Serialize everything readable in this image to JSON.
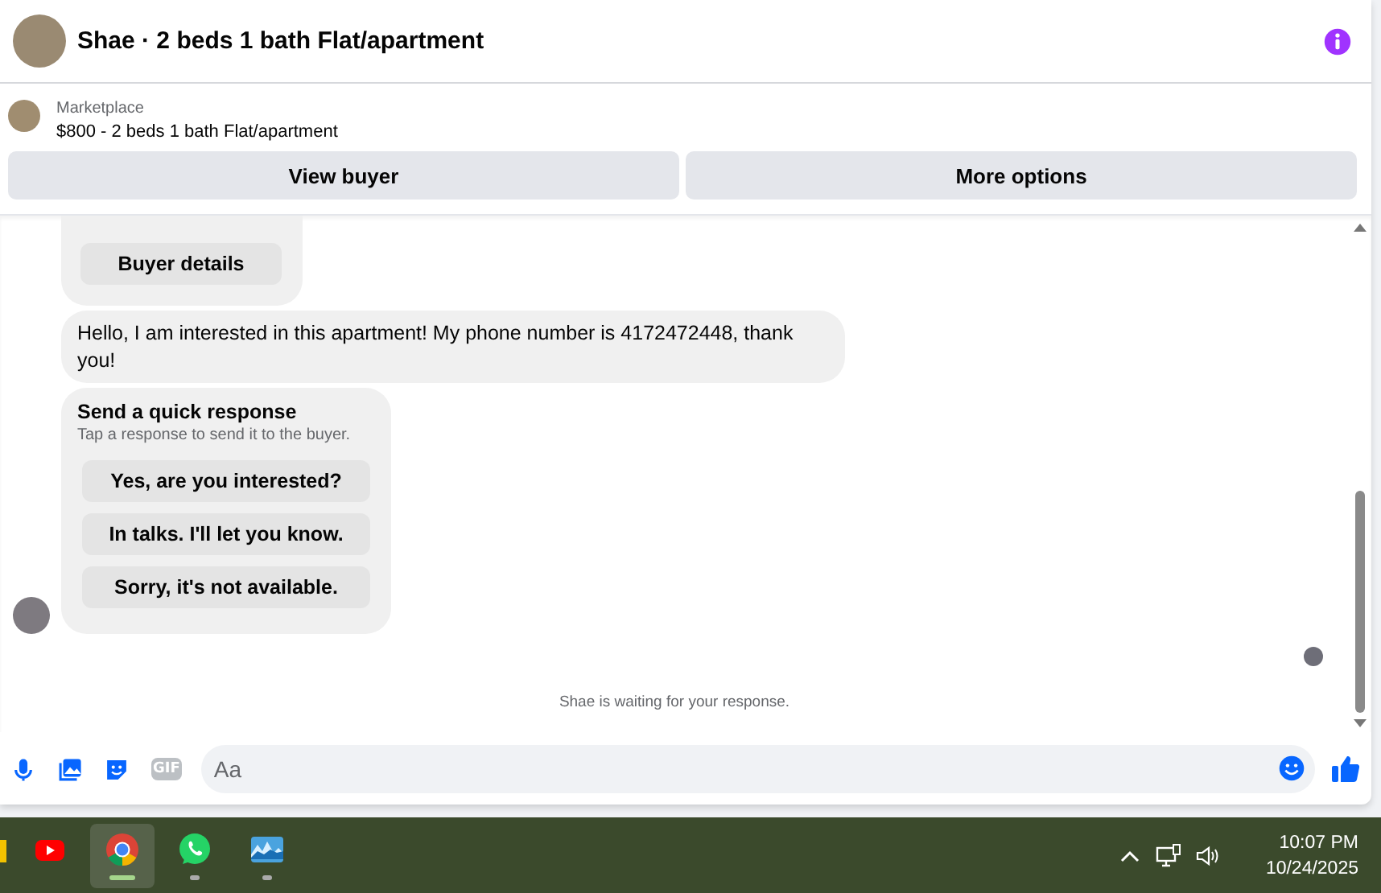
{
  "header": {
    "title": "Shae · 2 beds 1 bath Flat/apartment"
  },
  "listing": {
    "source": "Marketplace",
    "title": "$800 - 2 beds 1 bath Flat/apartment"
  },
  "actions": [
    "View buyer",
    "More options"
  ],
  "messages": [
    {
      "kind": "card",
      "button": "Buyer details"
    },
    {
      "kind": "text",
      "text": "Hello, I am interested in this apartment! My phone number is 4172472448, thank you!"
    },
    {
      "kind": "quick",
      "title": "Send a quick response",
      "subtitle": "Tap a response to send it to the buyer.",
      "options": [
        "Yes, are you interested?",
        "In talks. I'll let you know.",
        "Sorry, it's not available."
      ]
    }
  ],
  "status": "Shae is waiting for your response.",
  "composer": {
    "gif_label": "GIF",
    "placeholder": "Aa"
  },
  "taskbar": {
    "apps": [
      {
        "kind": "files",
        "selected": false,
        "running": false
      },
      {
        "kind": "youtube",
        "selected": false,
        "running": false
      },
      {
        "kind": "chrome",
        "selected": true,
        "running": true
      },
      {
        "kind": "whatsapp",
        "selected": false,
        "running": true
      },
      {
        "kind": "photos",
        "selected": false,
        "running": true
      }
    ],
    "time": "10:07 PM",
    "date": "10/24/2025"
  }
}
